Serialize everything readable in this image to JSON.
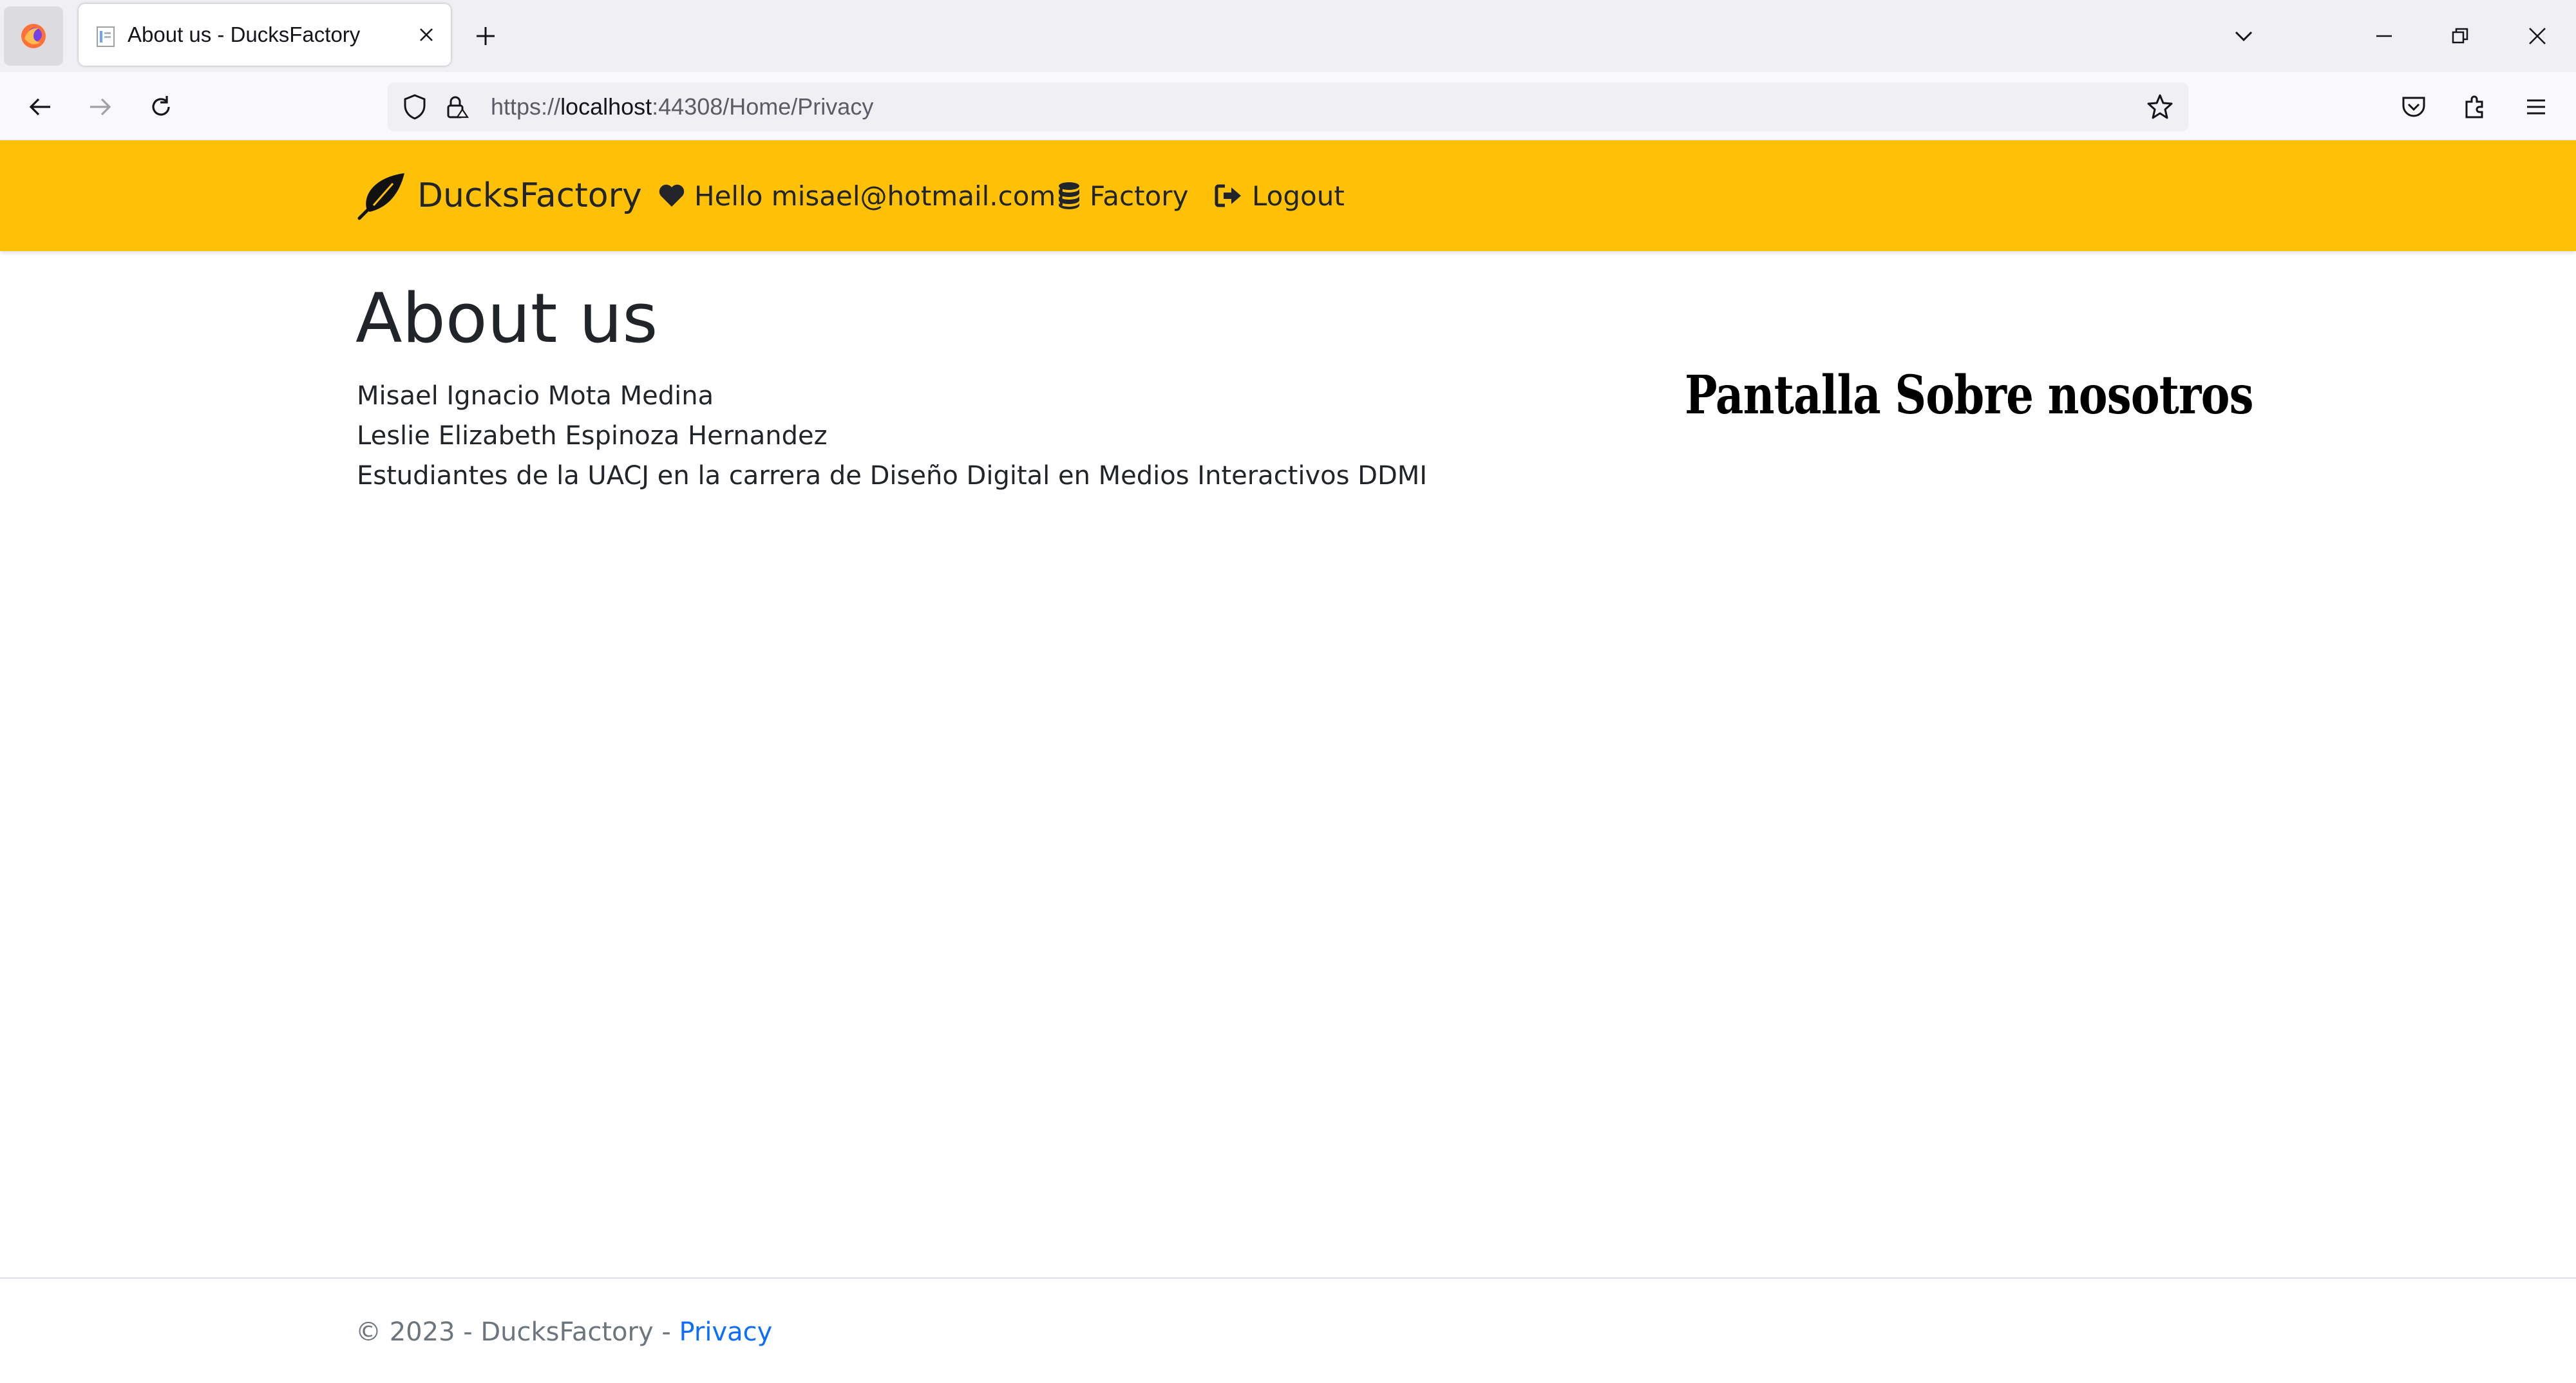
{
  "browser": {
    "tab_title": "About us - DucksFactory",
    "url_prefix": "https://",
    "url_host": "localhost",
    "url_rest": ":44308/Home/Privacy"
  },
  "site": {
    "brand": "DucksFactory",
    "nav": {
      "greeting": "Hello misael@hotmail.com!",
      "factory": "Factory",
      "logout": "Logout"
    }
  },
  "main": {
    "title": "About us",
    "lines": [
      "Misael Ignacio Mota Medina",
      "Leslie Elizabeth Espinoza Hernandez",
      "Estudiantes de la UACJ en la carrera de Diseño Digital en Medios Interactivos DDMI"
    ],
    "banner": "Pantalla Sobre nosotros"
  },
  "footer": {
    "copyright": "© 2023 - DucksFactory - ",
    "privacy": "Privacy"
  },
  "colors": {
    "header_bg": "#ffc107",
    "link": "#0d6efd"
  }
}
